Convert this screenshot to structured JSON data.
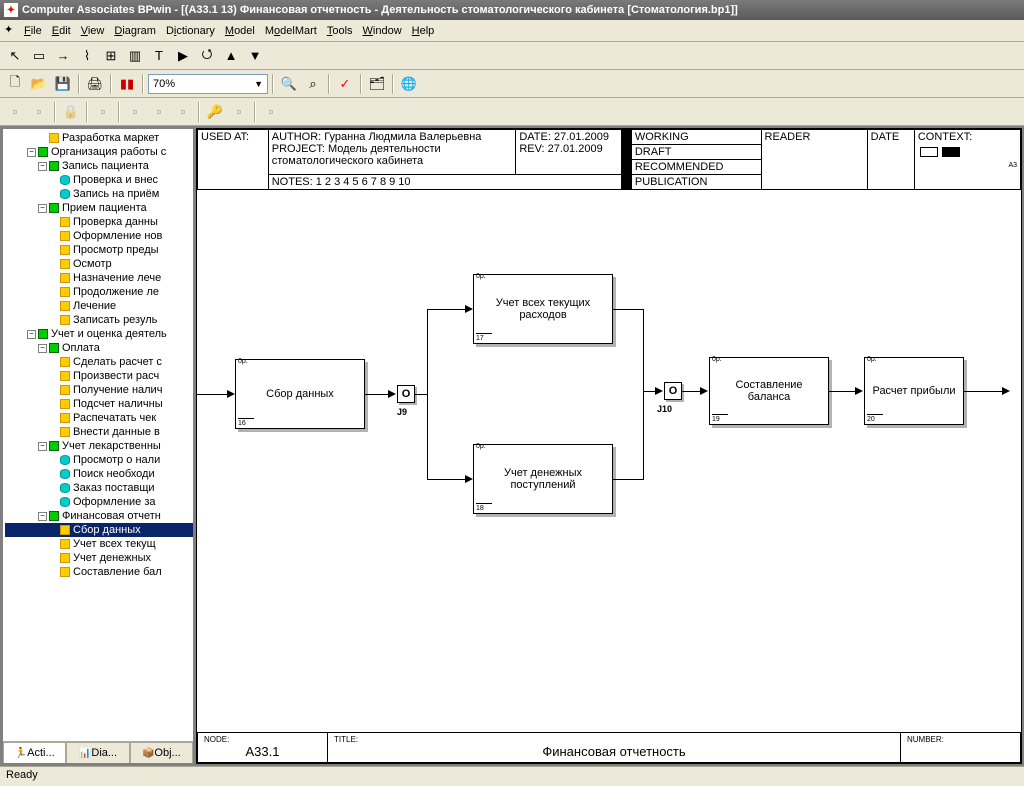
{
  "title": "Computer Associates BPwin - [(A33.1 13) Финансовая отчетность - Деятельность стоматологического кабинета [Стоматология.bp1]]",
  "menu": [
    "File",
    "Edit",
    "View",
    "Diagram",
    "Dictionary",
    "Model",
    "ModelMart",
    "Tools",
    "Window",
    "Help"
  ],
  "zoom": "70%",
  "tree": [
    {
      "indent": 3,
      "type": "y",
      "text": "Разработка  маркет"
    },
    {
      "indent": 2,
      "toggle": "-",
      "type": "g",
      "text": "Организация работы с"
    },
    {
      "indent": 3,
      "toggle": "-",
      "type": "g",
      "text": "Запись пациента"
    },
    {
      "indent": 4,
      "type": "c",
      "text": "Проверка  и внес"
    },
    {
      "indent": 4,
      "type": "c",
      "text": "Запись  на  приём"
    },
    {
      "indent": 3,
      "toggle": "-",
      "type": "g",
      "text": "Прием пациента"
    },
    {
      "indent": 4,
      "type": "y",
      "text": "Проверка  данны"
    },
    {
      "indent": 4,
      "type": "y",
      "text": "Оформление  нов"
    },
    {
      "indent": 4,
      "type": "y",
      "text": "Просмотр  преды"
    },
    {
      "indent": 4,
      "type": "y",
      "text": "Осмотр"
    },
    {
      "indent": 4,
      "type": "y",
      "text": "Назначение  лече"
    },
    {
      "indent": 4,
      "type": "y",
      "text": "Продолжение  ле"
    },
    {
      "indent": 4,
      "type": "y",
      "text": "Лечение"
    },
    {
      "indent": 4,
      "type": "y",
      "text": "Записать  резуль"
    },
    {
      "indent": 2,
      "toggle": "-",
      "type": "g",
      "text": "Учет и оценка  деятель"
    },
    {
      "indent": 3,
      "toggle": "-",
      "type": "g",
      "text": "Оплата"
    },
    {
      "indent": 4,
      "type": "y",
      "text": "Сделать расчет  с"
    },
    {
      "indent": 4,
      "type": "y",
      "text": "Произвести расч"
    },
    {
      "indent": 4,
      "type": "y",
      "text": "Получение  налич"
    },
    {
      "indent": 4,
      "type": "y",
      "text": "Подсчет  наличны"
    },
    {
      "indent": 4,
      "type": "y",
      "text": "Распечатать  чек"
    },
    {
      "indent": 4,
      "type": "y",
      "text": "Внести данные  в"
    },
    {
      "indent": 3,
      "toggle": "-",
      "type": "g",
      "text": "Учет лекарственны"
    },
    {
      "indent": 4,
      "type": "c",
      "text": "Просмотр о нали"
    },
    {
      "indent": 4,
      "type": "c",
      "text": "Поиск необходи"
    },
    {
      "indent": 4,
      "type": "c",
      "text": "Заказ поставщи"
    },
    {
      "indent": 4,
      "type": "c",
      "text": "Оформление  за"
    },
    {
      "indent": 3,
      "toggle": "-",
      "type": "g",
      "text": "Финансовая  отчетн"
    },
    {
      "indent": 4,
      "type": "y",
      "text": "Сбор данных",
      "selected": true
    },
    {
      "indent": 4,
      "type": "y",
      "text": "Учет всех текущ"
    },
    {
      "indent": 4,
      "type": "y",
      "text": "Учет денежных"
    },
    {
      "indent": 4,
      "type": "y",
      "text": "Составление  бал"
    }
  ],
  "sideTabs": [
    "Acti...",
    "Dia...",
    "Obj..."
  ],
  "header": {
    "usedAt": "USED AT:",
    "author": "AUTHOR:  Гуранна Людмила Валерьевна",
    "project": "PROJECT:  Модель деятельности стоматологического кабинета",
    "date": "DATE: 27.01.2009",
    "rev": "REV:  27.01.2009",
    "notes": "NOTES:  1  2  3  4  5  6  7  8  9  10",
    "statuses": [
      "WORKING",
      "DRAFT",
      "RECOMMENDED",
      "PUBLICATION"
    ],
    "reader": "READER",
    "dateCol": "DATE",
    "context": "CONTEXT:",
    "a3": "A3"
  },
  "boxes": {
    "b1": {
      "label": "Сбор данных",
      "top": "0р.",
      "bot": "16"
    },
    "b2": {
      "label": "Учет всех текущих расходов",
      "top": "0р.",
      "bot": "17"
    },
    "b3": {
      "label": "Учет денежных поступлений",
      "top": "0р.",
      "bot": "18"
    },
    "b4": {
      "label": "Составление баланса",
      "top": "0р.",
      "bot": "19"
    },
    "b5": {
      "label": "Расчет прибыли",
      "top": "0р.",
      "bot": "20"
    }
  },
  "junctions": {
    "j9": "J9",
    "j10": "J10",
    "o": "O"
  },
  "footer": {
    "nodeLbl": "NODE:",
    "node": "A33.1",
    "titleLbl": "TITLE:",
    "title": "Финансовая отчетность",
    "numLbl": "NUMBER:"
  },
  "status": "Ready"
}
